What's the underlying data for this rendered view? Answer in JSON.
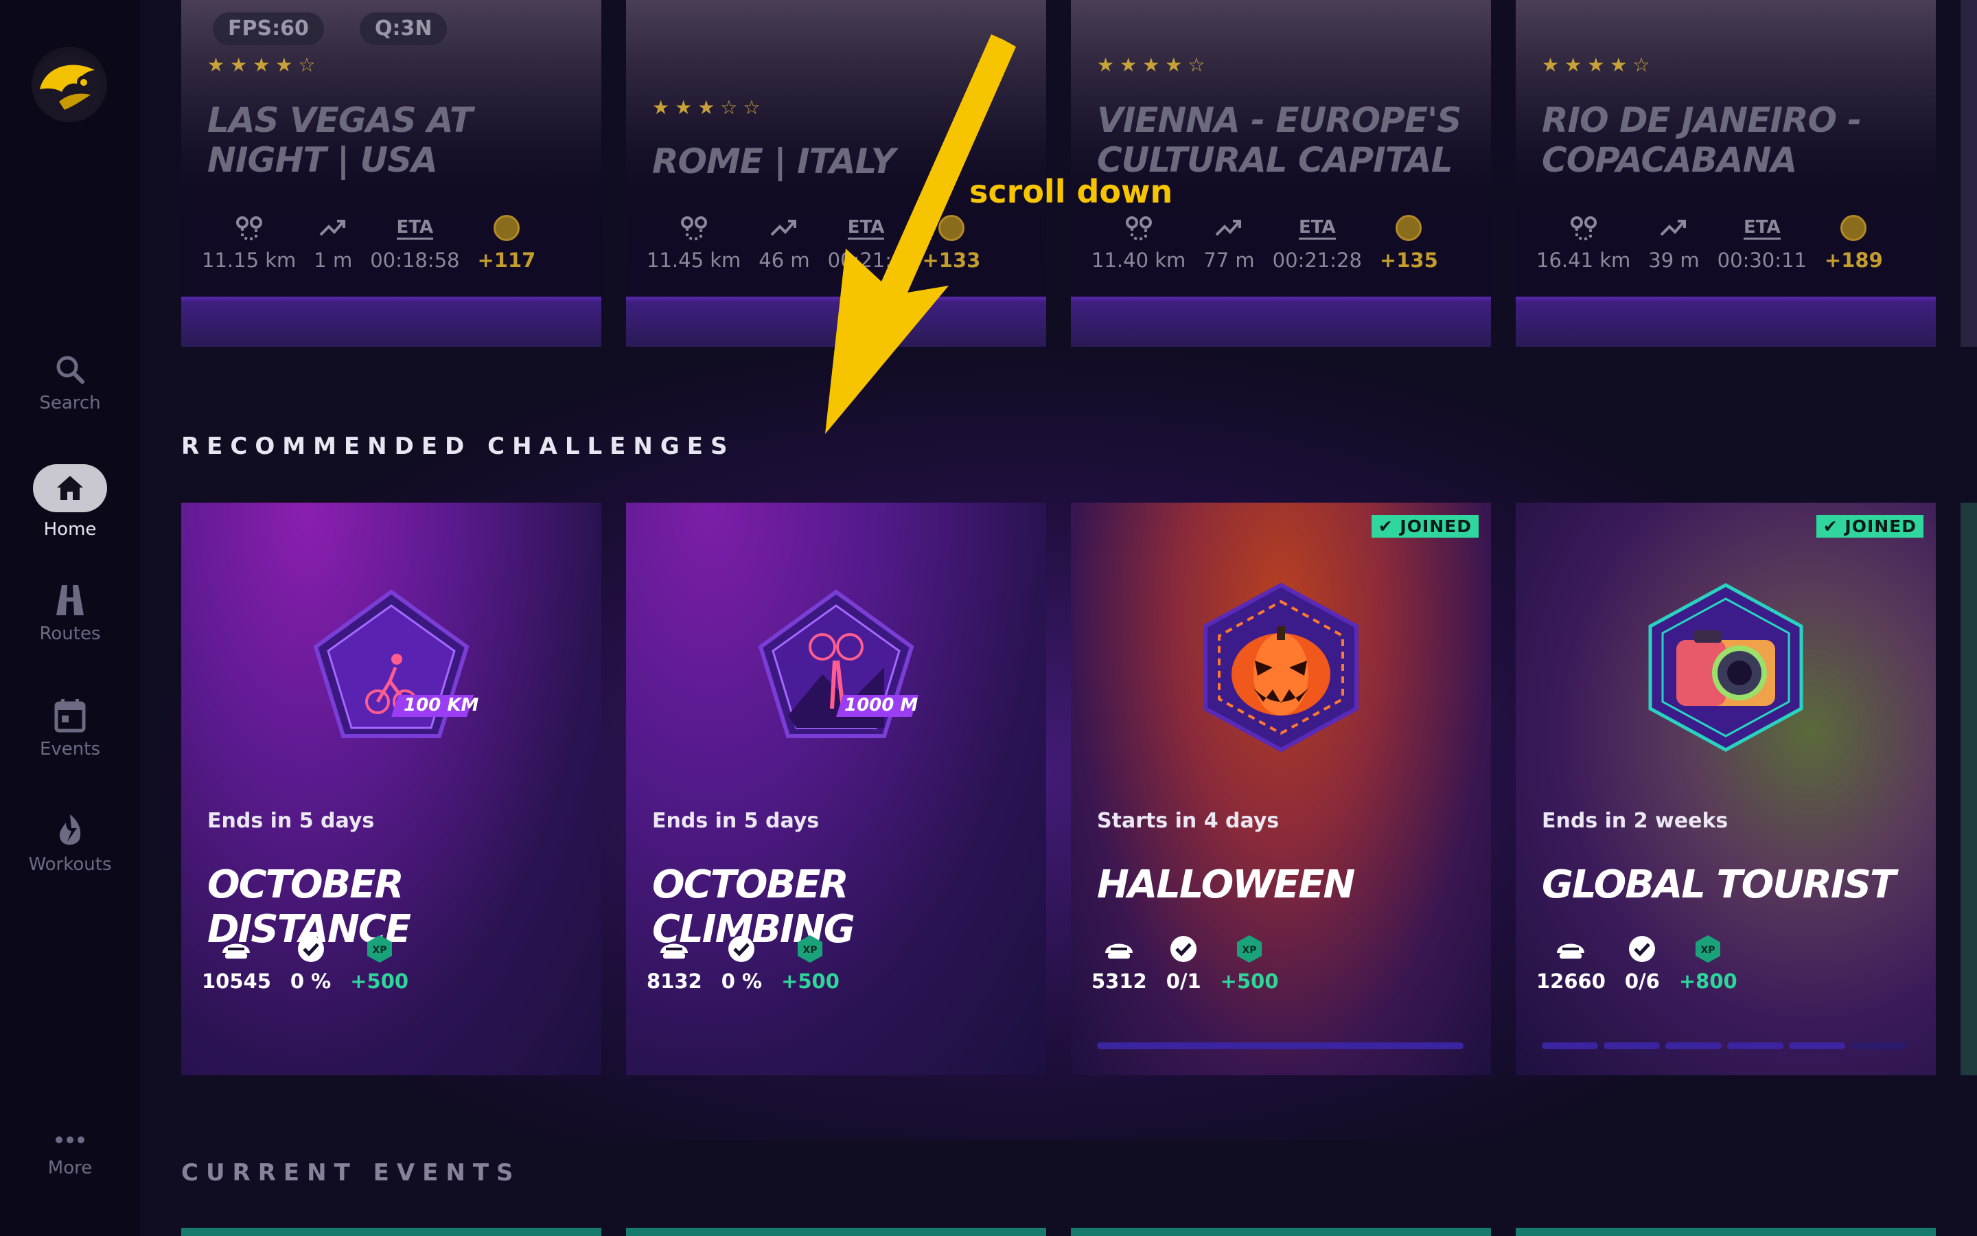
{
  "nav": {
    "items": [
      {
        "label": "Search",
        "icon": "search-icon"
      },
      {
        "label": "Home",
        "icon": "home-icon",
        "active": true
      },
      {
        "label": "Routes",
        "icon": "road-icon"
      },
      {
        "label": "Events",
        "icon": "calendar-icon"
      },
      {
        "label": "Workouts",
        "icon": "bolt-icon"
      },
      {
        "label": "More",
        "icon": "ellipsis-icon"
      }
    ]
  },
  "overlay": {
    "fps": "FPS:60",
    "quality": "Q:3N"
  },
  "routes": [
    {
      "title": "LAS VEGAS AT NIGHT | USA",
      "rating": 4,
      "distance": "11.15 km",
      "elevation": "1 m",
      "eta": "00:18:58",
      "coins": "+117"
    },
    {
      "title": "ROME |  ITALY",
      "rating": 3,
      "distance": "11.45 km",
      "elevation": "46 m",
      "eta": "00:21:1",
      "coins": "+133"
    },
    {
      "title": "VIENNA - EUROPE'S CULTURAL CAPITAL",
      "rating": 4,
      "distance": "11.40 km",
      "elevation": "77 m",
      "eta": "00:21:28",
      "coins": "+135"
    },
    {
      "title": "RIO DE JANEIRO - COPACABANA",
      "rating": 4,
      "distance": "16.41 km",
      "elevation": "39 m",
      "eta": "00:30:11",
      "coins": "+189"
    }
  ],
  "eta_label": "ETA",
  "sections": {
    "challenges": "RECOMMENDED CHALLENGES",
    "events": "CURRENT EVENTS"
  },
  "challenges": [
    {
      "when": "Ends in 5 days",
      "title": "OCTOBER DISTANCE",
      "participants": "10545",
      "progress": "0 %",
      "xp": "+500",
      "badge_label": "100 KM",
      "joined": false
    },
    {
      "when": "Ends in 5 days",
      "title": "OCTOBER CLIMBING",
      "participants": "8132",
      "progress": "0 %",
      "xp": "+500",
      "badge_label": "1000 M",
      "joined": false
    },
    {
      "when": "Starts in 4 days",
      "title": "HALLOWEEN",
      "participants": "5312",
      "progress": "0/1",
      "xp": "+500",
      "joined": true,
      "joined_label": "JOINED",
      "segments": 1
    },
    {
      "when": "Ends in 2 weeks",
      "title": "GLOBAL TOURIST",
      "participants": "12660",
      "progress": "0/6",
      "xp": "+800",
      "joined": true,
      "joined_label": "JOINED",
      "segments": 6
    }
  ],
  "xp_label": "XP",
  "annotation": {
    "text": "scroll down",
    "color": "#f7c500"
  },
  "colors": {
    "accent_green": "#2fd69e",
    "coin_gold": "#c49e2d",
    "purple_bar": "#5a2ab0"
  }
}
